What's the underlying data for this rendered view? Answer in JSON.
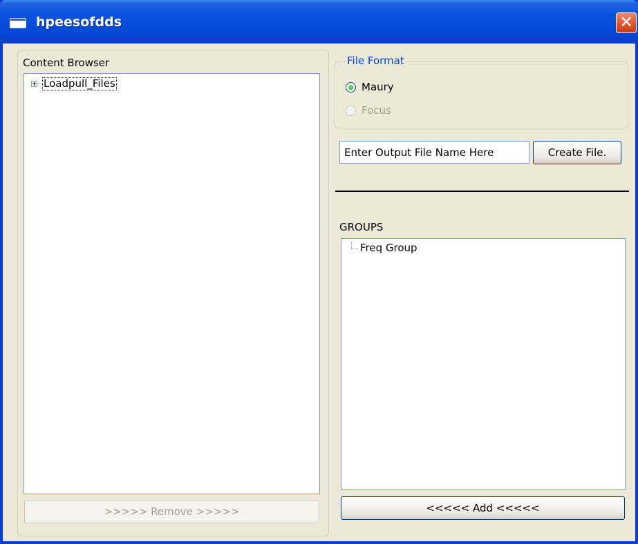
{
  "window": {
    "title": "hpeesofdds",
    "close_label": "✕"
  },
  "content_browser": {
    "label": "Content Browser",
    "tree_item": "Loadpull_Files",
    "remove_label": ">>>>> Remove >>>>>"
  },
  "file_format": {
    "legend": "File Format",
    "options": [
      {
        "label": "Maury",
        "checked": true,
        "disabled": false
      },
      {
        "label": "Focus",
        "checked": false,
        "disabled": true
      }
    ]
  },
  "output": {
    "input_value": "Enter Output File Name Here",
    "create_label": "Create File."
  },
  "groups": {
    "label": "GROUPS",
    "item": "Freq Group",
    "add_label": "<<<<< Add <<<<<"
  },
  "colors": {
    "title_bar": "#0a53e0",
    "window_bg": "#ece9d8",
    "legend_text": "#0046d5",
    "close_button": "#e0502a"
  }
}
